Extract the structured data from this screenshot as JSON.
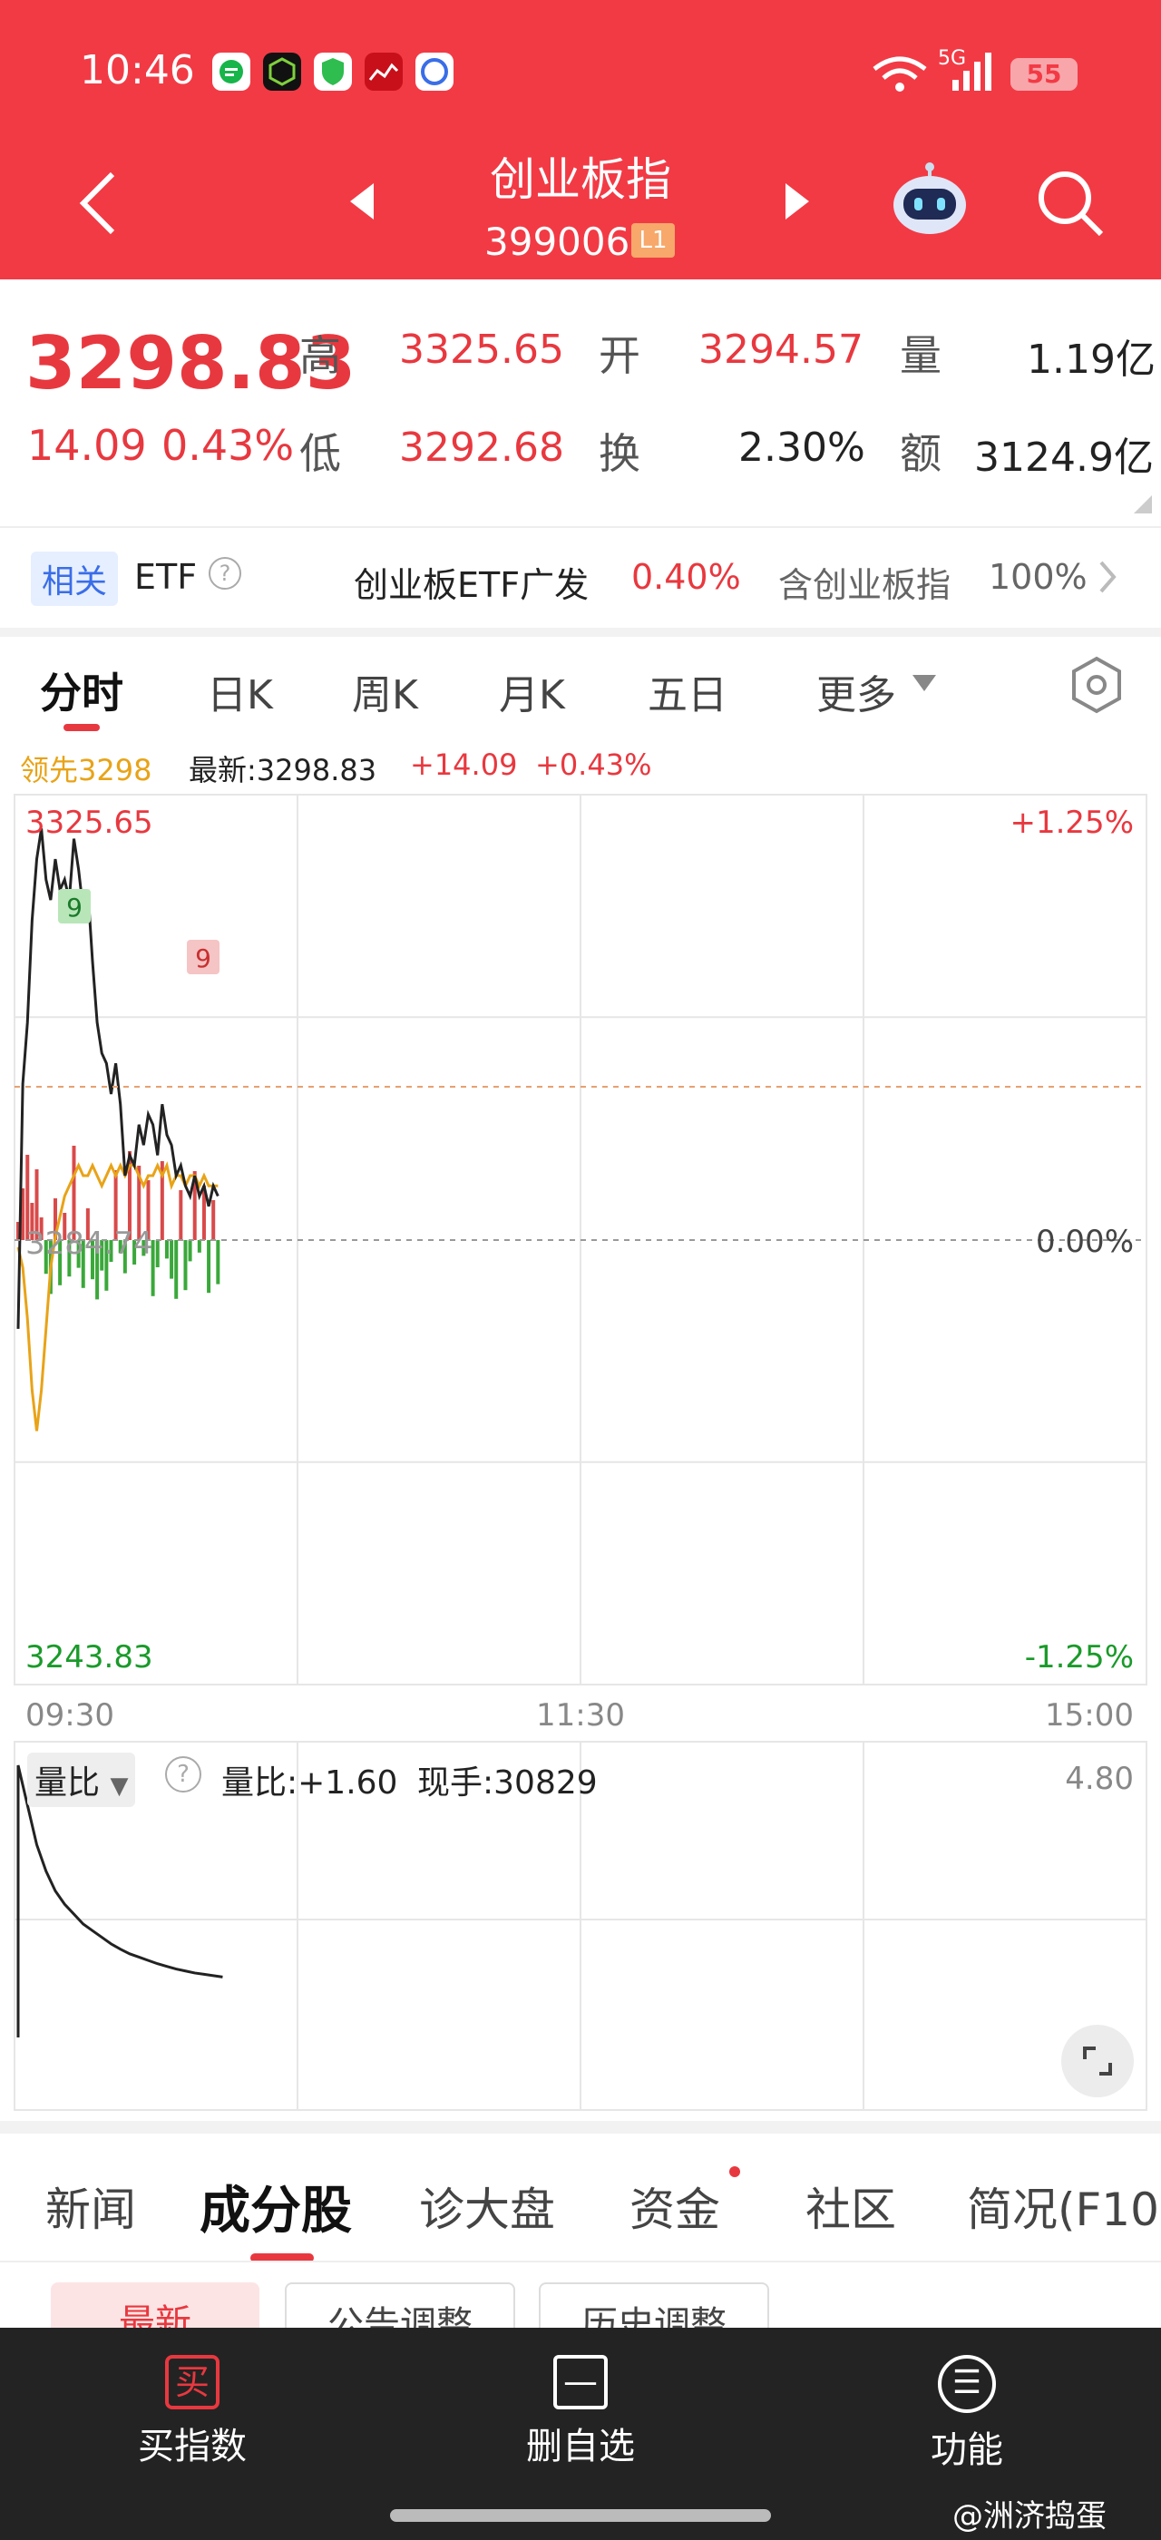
{
  "status_bar": {
    "time": "10:46",
    "network": "5G",
    "battery": "55"
  },
  "header": {
    "title": "创业板指",
    "code": "399006",
    "level_badge": "L1"
  },
  "quote": {
    "price": "3298.83",
    "change": "14.09",
    "change_pct": "0.43%",
    "high_label": "高",
    "high": "3325.65",
    "open_label": "开",
    "open": "3294.57",
    "volume_label": "量",
    "volume": "1.19亿",
    "low_label": "低",
    "low": "3292.68",
    "turnover_label": "换",
    "turnover": "2.30%",
    "amount_label": "额",
    "amount": "3124.9亿"
  },
  "etf": {
    "tag": "相关",
    "etf_label": "ETF",
    "help_icon": "?",
    "name": "创业板ETF广发",
    "change": "0.40%",
    "holding_label": "含创业板指",
    "holding_pct": "100%"
  },
  "chart_tabs": [
    "分时",
    "日K",
    "周K",
    "月K",
    "五日",
    "更多"
  ],
  "chart_header": {
    "lead": "领先3298",
    "latest": "最新:3298.83",
    "change": "+14.09",
    "change_pct": "+0.43%"
  },
  "chart_data": {
    "type": "line",
    "price_axis": {
      "top": "3325.65",
      "bottom": "3243.83",
      "mid": "3284.74",
      "top_pct": "+1.25%",
      "mid_pct": "0.00%",
      "bottom_pct": "-1.25%"
    },
    "time_axis": [
      "09:30",
      "11:30",
      "15:00"
    ],
    "price_series": [
      3276,
      3300,
      3306,
      3316,
      3322,
      3325,
      3320,
      3318,
      3322,
      3319,
      3320,
      3318,
      3324,
      3321,
      3317,
      3319,
      3312,
      3306,
      3303,
      3302,
      3299,
      3302,
      3298,
      3291,
      3293,
      3292,
      3296,
      3294,
      3297,
      3296,
      3293,
      3298,
      3295,
      3294,
      3291,
      3292,
      3290,
      3289,
      3291,
      3289,
      3290,
      3288,
      3290,
      3289
    ],
    "lead_series": [
      3284,
      3282,
      3277,
      3270,
      3266,
      3270,
      3276,
      3282,
      3285,
      3287,
      3289,
      3290,
      3291,
      3292,
      3291,
      3291,
      3292,
      3291,
      3290,
      3291,
      3292,
      3291,
      3292,
      3291,
      3292,
      3292,
      3291,
      3290,
      3291,
      3291,
      3292,
      3291,
      3292,
      3290,
      3291,
      3291,
      3290,
      3291,
      3291,
      3290,
      3291,
      3290,
      3290,
      3290
    ],
    "volume_ratio_series": [
      4.8,
      4.2,
      3.6,
      3.2,
      2.9,
      2.7,
      2.55,
      2.4,
      2.3,
      2.2,
      2.1,
      2.02,
      1.95,
      1.9,
      1.85,
      1.8,
      1.76,
      1.72,
      1.69,
      1.66,
      1.64,
      1.62,
      1.6
    ],
    "volume_ratio_max": "4.80"
  },
  "sub_indicator": {
    "name": "量比",
    "help_icon": "?",
    "ratio_text": "量比:+1.60",
    "current_hand": "现手:30829"
  },
  "bottom_tabs": [
    "新闻",
    "成分股",
    "诊大盘",
    "资金",
    "社区",
    "简况(F10"
  ],
  "sub_filters": [
    "最新",
    "公告调整",
    "历史调整"
  ],
  "bottom_bar": [
    {
      "icon": "买",
      "label": "买指数"
    },
    {
      "icon": "—",
      "label": "删自选"
    },
    {
      "icon": "☰",
      "label": "功能"
    }
  ],
  "watermark": "@洲济捣蛋",
  "colors": {
    "header": "#f23a45",
    "up": "#e8383f",
    "down": "#1a9a2a",
    "lead": "#e8a317"
  }
}
